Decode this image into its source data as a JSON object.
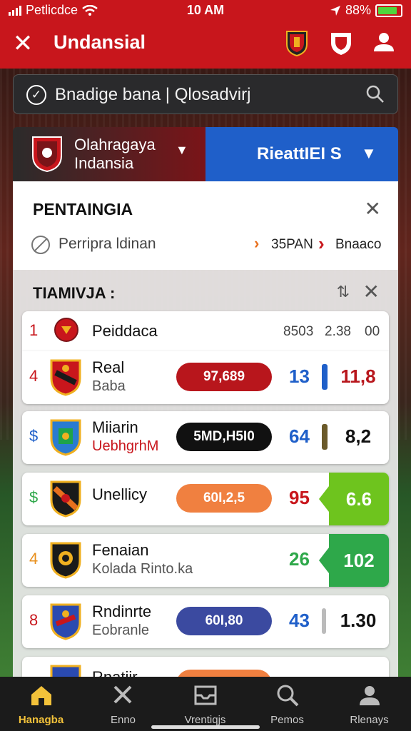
{
  "status": {
    "carrier": "Petlicdce",
    "time": "10 AM",
    "battery": "88%",
    "battery_level": 0.88
  },
  "header": {
    "title": "Undansial"
  },
  "search": {
    "text": "Bnadige bana | Qlosadvirj"
  },
  "selector": {
    "team_line1": "Olahragaya",
    "team_line2": "Indansia",
    "right_label": "RieattIEI S"
  },
  "notice": {
    "title": "PENTAINGIA",
    "text": "Perripra ldinan",
    "time": "35PAN",
    "value": "Bnaaco"
  },
  "table": {
    "title": "TIAMIVJA :",
    "header_row": {
      "rank": "1",
      "team": "Peiddaca",
      "c1": "8503",
      "c2": "2.38",
      "c3": "00"
    },
    "rows": [
      {
        "rank": "4",
        "team": "Real",
        "sub": "Baba",
        "pill": "97,689",
        "score": "13",
        "pts": "11,8"
      },
      {
        "rank": "$",
        "team": "Miiarin",
        "sub": "UebhgrhM",
        "pill": "5MD,H5I0",
        "score": "64",
        "pts": "8,2"
      },
      {
        "rank": "$",
        "team": "Unellicy",
        "sub": "",
        "pill": "60I,2,5",
        "score": "95",
        "pts": "6.6"
      },
      {
        "rank": "4",
        "team": "Fenaian",
        "sub": "Kolada Rinto.ka",
        "pill": "",
        "score": "26",
        "pts": "102"
      },
      {
        "rank": "8",
        "team": "Rndinrte",
        "sub": "Eobranle",
        "pill": "60I,80",
        "score": "43",
        "pts": "1.30"
      },
      {
        "rank": "",
        "team": "Rnatiir",
        "sub": "",
        "pill": "",
        "score": "",
        "pts": ""
      }
    ]
  },
  "nav": [
    {
      "label": "Hanagba",
      "icon": "home-icon"
    },
    {
      "label": "Enno",
      "icon": "tools-icon"
    },
    {
      "label": "Vrentiqjs",
      "icon": "inbox-icon"
    },
    {
      "label": "Pemos",
      "icon": "search-icon"
    },
    {
      "label": "Rlenays",
      "icon": "profile-icon"
    }
  ],
  "colors": {
    "primary_red": "#c8161c",
    "blue": "#1f5fc9",
    "green": "#2ea84a",
    "lime": "#6ec41e",
    "orange": "#f08040",
    "navy": "#3b4aa0"
  }
}
